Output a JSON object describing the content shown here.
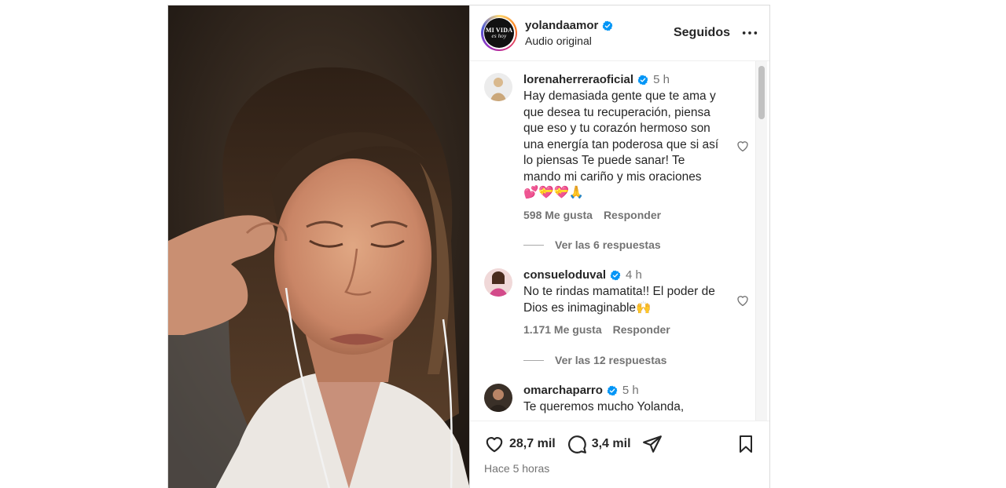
{
  "post": {
    "username": "yolandaamor",
    "audio_label": "Audio original",
    "follow_label": "Seguidos",
    "logo": {
      "line1": "MI VIDA",
      "line2": "es hoy"
    },
    "likes": "28,7 mil",
    "comments_count": "3,4 mil",
    "time_ago": "Hace 5 horas"
  },
  "comments": [
    {
      "username": "lorenaherreraoficial",
      "time": "5 h",
      "text": "Hay demasiada gente que te ama y que desea tu recuperación, piensa que eso y tu corazón hermoso son una energía tan poderosa que si así lo piensas Te puede sanar! Te mando mi cariño y mis oraciones 💕💝💝🙏",
      "likes": "598 Me gusta",
      "reply_label": "Responder",
      "view_replies": "Ver las 6 respuestas"
    },
    {
      "username": "consueloduval",
      "time": "4 h",
      "text": "No te rindas mamatita!! El poder de Dios es inimaginable🙌",
      "likes": "1.171 Me gusta",
      "reply_label": "Responder",
      "view_replies": "Ver las 12 respuestas"
    },
    {
      "username": "omarchaparro",
      "time": "5 h",
      "text": "Te queremos mucho Yolanda,"
    }
  ],
  "colors": {
    "verified": "#0095f6",
    "secondary_text": "#737373",
    "primary_text": "#262626"
  },
  "icons": {
    "verified": "verified-badge-icon",
    "more": "more-horizontal-icon",
    "heart": "heart-icon",
    "comment": "comment-bubble-icon",
    "share": "paper-plane-icon",
    "save": "bookmark-icon"
  }
}
